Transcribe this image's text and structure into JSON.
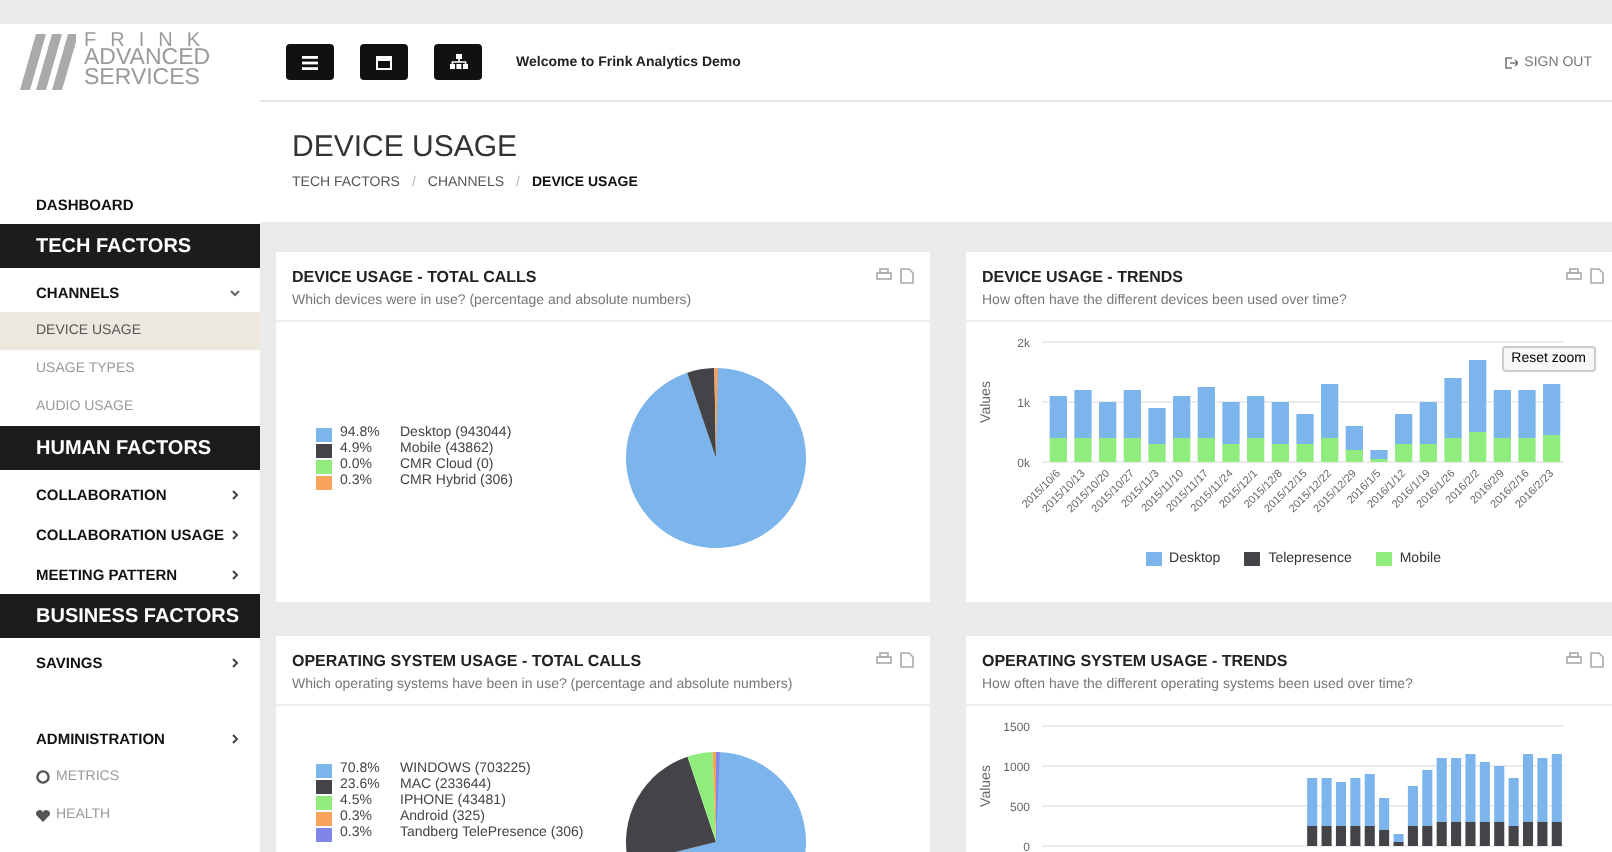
{
  "logo": {
    "lines": [
      "FRINK",
      "ADVANCED",
      "SERVICES"
    ]
  },
  "toolbar": {
    "buttons": [
      {
        "kind": "menu"
      },
      {
        "kind": "calendar"
      },
      {
        "kind": "sitemap"
      }
    ],
    "welcome": "Welcome to Frink Analytics Demo",
    "sign_out": "SIGN OUT"
  },
  "sidebar": {
    "items": [
      {
        "kind": "link",
        "label": "DASHBOARD"
      },
      {
        "kind": "section",
        "label": "TECH FACTORS"
      },
      {
        "kind": "group",
        "label": "CHANNELS",
        "expanded": true,
        "children": [
          {
            "label": "DEVICE USAGE",
            "selected": true
          },
          {
            "label": "USAGE TYPES",
            "selected": false
          },
          {
            "label": "AUDIO USAGE",
            "selected": false
          }
        ]
      },
      {
        "kind": "section",
        "label": "HUMAN FACTORS"
      },
      {
        "kind": "group",
        "label": "COLLABORATION",
        "expanded": false
      },
      {
        "kind": "group",
        "label": "COLLABORATION USAGE",
        "expanded": false
      },
      {
        "kind": "group",
        "label": "MEETING PATTERN",
        "expanded": false
      },
      {
        "kind": "section",
        "label": "BUSINESS FACTORS"
      },
      {
        "kind": "group",
        "label": "SAVINGS",
        "expanded": false
      },
      {
        "kind": "spacer"
      },
      {
        "kind": "group",
        "label": "ADMINISTRATION",
        "expanded": false
      },
      {
        "kind": "gauge",
        "label": "METRICS"
      },
      {
        "kind": "heart",
        "label": "HEALTH"
      }
    ]
  },
  "page": {
    "title": "DEVICE USAGE",
    "separators": [
      "/",
      "/"
    ],
    "breadcrumb": [
      {
        "label": "TECH FACTORS",
        "current": false
      },
      {
        "label": "CHANNELS",
        "current": false
      },
      {
        "label": "DEVICE USAGE",
        "current": true
      }
    ]
  },
  "cards": [
    {
      "title": "DEVICE USAGE - TOTAL CALLS",
      "subtitle": "Which devices were in use? (percentage and absolute numbers)",
      "legend": [
        {
          "share": "94.8%",
          "color": "#7cb5ec"
        },
        {
          "share": "4.9%",
          "color": "#434348"
        },
        {
          "share": "0.0%",
          "color": "#90ed7d"
        },
        {
          "share": "0.3%",
          "color": "#f7a35c"
        }
      ],
      "chart_data": {
        "type": "pie",
        "categories": [
          "Desktop (943044)",
          "Mobile (43862)",
          "CMR Cloud (0)",
          "CMR Hybrid (306)"
        ],
        "values": [
          94.8,
          4.9,
          0.0,
          0.3
        ]
      }
    },
    {
      "title": "DEVICE USAGE - TRENDS",
      "subtitle": "How often have the different devices been used over time?",
      "reset": "Reset zoom",
      "chart_data": {
        "type": "bar",
        "stacked": true,
        "ylabel": "Values",
        "categories": [
          "2015/10/6",
          "2015/10/13",
          "2015/10/20",
          "2015/10/27",
          "2015/11/3",
          "2015/11/10",
          "2015/11/17",
          "2015/11/24",
          "2015/12/1",
          "2015/12/8",
          "2015/12/15",
          "2015/12/22",
          "2015/12/29",
          "2016/1/5",
          "2016/1/12",
          "2016/1/19",
          "2016/1/26",
          "2016/2/2",
          "2016/2/9",
          "2016/2/16",
          "2016/2/23"
        ],
        "ylim": [
          0,
          2000
        ],
        "yticks": [
          {
            "value": 0,
            "label": "0k"
          },
          {
            "value": 1000,
            "label": "1k"
          },
          {
            "value": 2000,
            "label": "2k"
          }
        ],
        "series": [
          {
            "name": "Mobile",
            "color": "#90ed7d",
            "values": [
              400,
              400,
              400,
              400,
              300,
              400,
              400,
              300,
              400,
              300,
              300,
              400,
              200,
              50,
              300,
              300,
              400,
              500,
              400,
              400,
              450
            ]
          },
          {
            "name": "Telepresence",
            "color": "#434348",
            "values": [
              0,
              0,
              0,
              0,
              0,
              0,
              0,
              0,
              0,
              0,
              0,
              0,
              0,
              0,
              0,
              0,
              0,
              0,
              0,
              0,
              0
            ]
          },
          {
            "name": "Desktop",
            "color": "#7cb5ec",
            "values": [
              700,
              800,
              600,
              800,
              600,
              700,
              850,
              700,
              700,
              700,
              500,
              900,
              400,
              150,
              500,
              700,
              1000,
              1200,
              800,
              800,
              850
            ]
          }
        ]
      }
    },
    {
      "title": "OPERATING SYSTEM USAGE - TOTAL CALLS",
      "subtitle": "Which operating systems have been in use? (percentage and absolute numbers)",
      "legend": [
        {
          "share": "70.8%",
          "color": "#7cb5ec"
        },
        {
          "share": "23.6%",
          "color": "#434348"
        },
        {
          "share": "4.5%",
          "color": "#90ed7d"
        },
        {
          "share": "0.3%",
          "color": "#f7a35c"
        },
        {
          "share": "0.3%",
          "color": "#8085e9"
        }
      ],
      "chart_data": {
        "type": "pie",
        "categories": [
          "WINDOWS (703225)",
          "MAC (233644)",
          "IPHONE (43481)",
          "Android (325)",
          "Tandberg TelePresence (306)"
        ],
        "values": [
          70.8,
          23.6,
          4.5,
          0.3,
          0.3
        ]
      }
    },
    {
      "title": "OPERATING SYSTEM USAGE - TRENDS",
      "subtitle": "How often have the different operating systems been used over time?",
      "chart_data": {
        "type": "bar",
        "stacked": true,
        "ylabel": "Values",
        "ylim": [
          0,
          1500
        ],
        "yticks": [
          0,
          500,
          1000,
          1500
        ],
        "series": [
          {
            "color": "#434348",
            "values": [
              0,
              0,
              0,
              0,
              0,
              0,
              0,
              0,
              0,
              0,
              0,
              0,
              0,
              0,
              0,
              0,
              0,
              0,
              250,
              250,
              250,
              250,
              250,
              200,
              50,
              250,
              250,
              300,
              300,
              300,
              300,
              300,
              250,
              300,
              300,
              300
            ]
          },
          {
            "color": "#7cb5ec",
            "values": [
              0,
              0,
              0,
              0,
              0,
              0,
              0,
              0,
              0,
              0,
              0,
              0,
              0,
              0,
              0,
              0,
              0,
              0,
              600,
              600,
              550,
              600,
              650,
              400,
              100,
              500,
              700,
              800,
              800,
              850,
              750,
              700,
              600,
              850,
              800,
              850
            ]
          }
        ]
      }
    }
  ]
}
